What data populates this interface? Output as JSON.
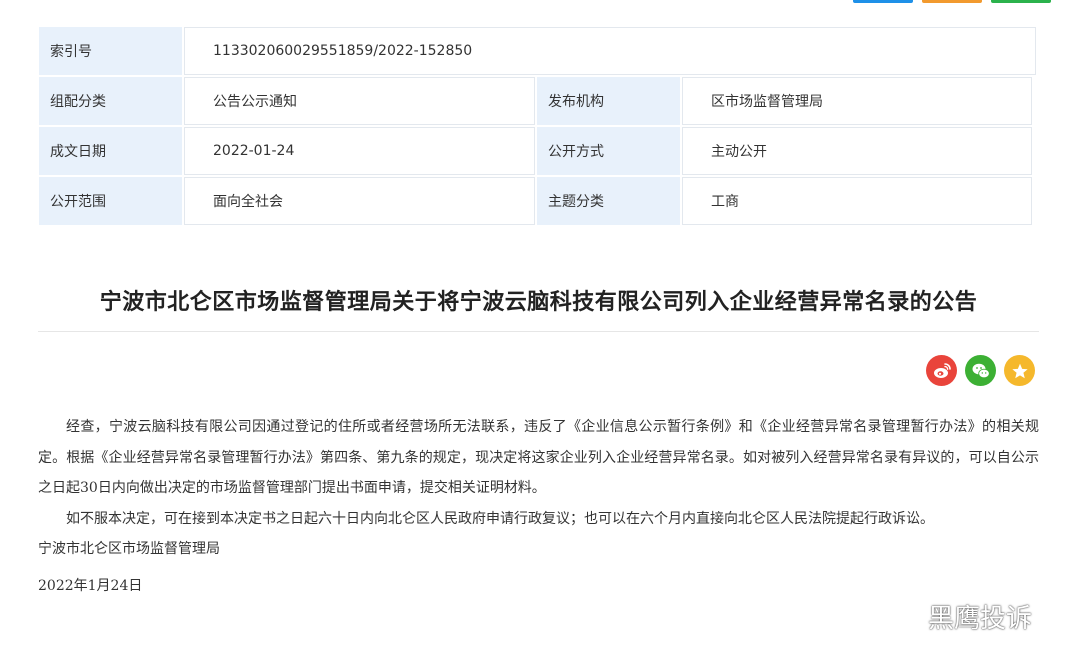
{
  "top_buttons": [
    "",
    "",
    ""
  ],
  "meta": {
    "index_label": "索引号",
    "index_value": "113302060029551859/2022-152850",
    "category_label": "组配分类",
    "category_value": "公告公示通知",
    "publisher_label": "发布机构",
    "publisher_value": "区市场监督管理局",
    "date_label": "成文日期",
    "date_value": "2022-01-24",
    "method_label": "公开方式",
    "method_value": "主动公开",
    "scope_label": "公开范围",
    "scope_value": "面向全社会",
    "topic_label": "主题分类",
    "topic_value": "工商"
  },
  "article": {
    "title": "宁波市北仑区市场监督管理局关于将宁波云脑科技有限公司列入企业经营异常名录的公告",
    "paragraph1": "经查，宁波云脑科技有限公司因通过登记的住所或者经营场所无法联系，违反了《企业信息公示暂行条例》和《企业经营异常名录管理暂行办法》的相关规定。根据《企业经营异常名录管理暂行办法》第四条、第九条的规定，现决定将这家企业列入企业经营异常名录。如对被列入经营异常名录有异议的，可以自公示之日起30日内向做出决定的市场监督管理部门提出书面申请，提交相关证明材料。",
    "paragraph2": "如不服本决定，可在接到本决定书之日起六十日内向北仑区人民政府申请行政复议；也可以在六个月内直接向北仑区人民法院提起行政诉讼。",
    "signature": "宁波市北仑区市场监督管理局",
    "date": "2022年1月24日"
  },
  "share": [
    "weibo-icon",
    "wechat-icon",
    "favorite-icon"
  ],
  "watermark": "黑鹰投诉"
}
